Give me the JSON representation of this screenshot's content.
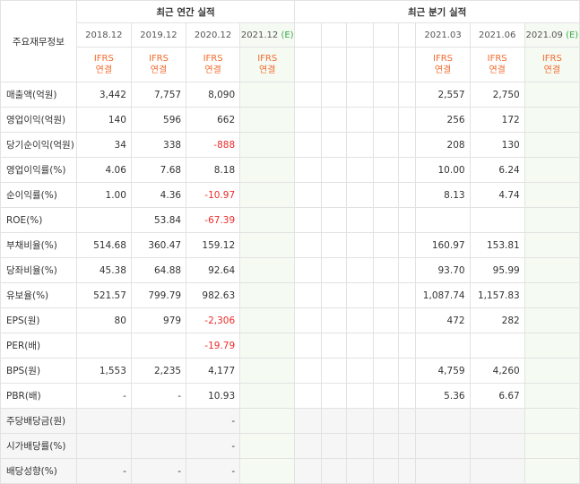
{
  "header": {
    "row_title": "주요재무정보",
    "annual_title": "최근 연간 실적",
    "quarter_title": "최근 분기 실적",
    "annual_periods": [
      "2018.12",
      "2019.12",
      "2020.12",
      "2021.12"
    ],
    "quarter_periods": [
      "2021.03",
      "2021.06",
      "2021.09"
    ],
    "estimate_mark": "(E)",
    "ifrs_line1": "IFRS",
    "ifrs_line2": "연결"
  },
  "rows": [
    {
      "label": "매출액(억원)",
      "annual": [
        "3,442",
        "7,757",
        "8,090",
        ""
      ],
      "quarter": [
        "2,557",
        "2,750",
        ""
      ]
    },
    {
      "label": "영업이익(억원)",
      "annual": [
        "140",
        "596",
        "662",
        ""
      ],
      "quarter": [
        "256",
        "172",
        ""
      ]
    },
    {
      "label": "당기순이익(억원)",
      "annual": [
        "34",
        "338",
        "-888",
        ""
      ],
      "quarter": [
        "208",
        "130",
        ""
      ]
    },
    {
      "label": "영업이익률(%)",
      "annual": [
        "4.06",
        "7.68",
        "8.18",
        ""
      ],
      "quarter": [
        "10.00",
        "6.24",
        ""
      ]
    },
    {
      "label": "순이익률(%)",
      "annual": [
        "1.00",
        "4.36",
        "-10.97",
        ""
      ],
      "quarter": [
        "8.13",
        "4.74",
        ""
      ]
    },
    {
      "label": "ROE(%)",
      "annual": [
        "",
        "53.84",
        "-67.39",
        ""
      ],
      "quarter": [
        "",
        "",
        ""
      ]
    },
    {
      "label": "부채비율(%)",
      "annual": [
        "514.68",
        "360.47",
        "159.12",
        ""
      ],
      "quarter": [
        "160.97",
        "153.81",
        ""
      ]
    },
    {
      "label": "당좌비율(%)",
      "annual": [
        "45.38",
        "64.88",
        "92.64",
        ""
      ],
      "quarter": [
        "93.70",
        "95.99",
        ""
      ]
    },
    {
      "label": "유보율(%)",
      "annual": [
        "521.57",
        "799.79",
        "982.63",
        ""
      ],
      "quarter": [
        "1,087.74",
        "1,157.83",
        ""
      ]
    },
    {
      "label": "EPS(원)",
      "annual": [
        "80",
        "979",
        "-2,306",
        ""
      ],
      "quarter": [
        "472",
        "282",
        ""
      ]
    },
    {
      "label": "PER(배)",
      "annual": [
        "",
        "",
        "-19.79",
        ""
      ],
      "quarter": [
        "",
        "",
        ""
      ]
    },
    {
      "label": "BPS(원)",
      "annual": [
        "1,553",
        "2,235",
        "4,177",
        ""
      ],
      "quarter": [
        "4,759",
        "4,260",
        ""
      ]
    },
    {
      "label": "PBR(배)",
      "annual": [
        "-",
        "-",
        "10.93",
        ""
      ],
      "quarter": [
        "5.36",
        "6.67",
        ""
      ]
    },
    {
      "label": "주당배당금(원)",
      "annual": [
        "",
        "",
        "-",
        ""
      ],
      "quarter": [
        "",
        "",
        ""
      ]
    },
    {
      "label": "시가배당률(%)",
      "annual": [
        "",
        "",
        "-",
        ""
      ],
      "quarter": [
        "",
        "",
        ""
      ]
    },
    {
      "label": "배당성향(%)",
      "annual": [
        "-",
        "-",
        "-",
        ""
      ],
      "quarter": [
        "",
        "",
        ""
      ]
    }
  ],
  "group_starts": [
    3,
    6,
    9,
    13
  ],
  "gray_rows": [
    13,
    14,
    15
  ],
  "colors": {
    "negative": "#ed2b2b",
    "ifrs": "#f26a2e",
    "estimate_bg": "#f5fbf3",
    "estimate_mark": "#3aa94a"
  }
}
